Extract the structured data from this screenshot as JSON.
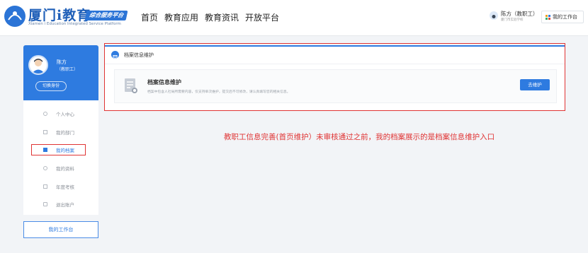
{
  "header": {
    "logo_title": "厦门i教育",
    "logo_subtitle": "Xiamen i Education Integrated Service Platform",
    "logo_badge": "综合服务平台",
    "nav": [
      "首页",
      "教育应用",
      "教育资讯",
      "开放平台"
    ],
    "user_name": "陈方（教职工）",
    "user_school": "厦门市实验学校",
    "workbench_label": "我的工作台"
  },
  "sidebar": {
    "name": "陈方",
    "role": "（教职工）",
    "switch_label": "切换身份",
    "menu": [
      {
        "label": "个人中心",
        "icon": "user-icon"
      },
      {
        "label": "我的部门",
        "icon": "department-icon"
      },
      {
        "label": "我的档案",
        "icon": "folder-icon"
      },
      {
        "label": "我的资料",
        "icon": "profile-icon"
      },
      {
        "label": "年度考核",
        "icon": "assessment-icon"
      },
      {
        "label": "退出账户",
        "icon": "logout-icon"
      }
    ],
    "active_item": "我的档案",
    "workbench_label": "我的工作台"
  },
  "panel": {
    "title": "档案信息维护",
    "item_title": "档案信息维护",
    "item_desc": "档案中包含人社局所需要内容，仅支持单次维护，提交后不可修改，请认真填写您的相关信息。",
    "button_label": "去维护"
  },
  "annotation": "教职工信息完善(首页维护）未审核通过之前，我的档案展示的是档案信息维护入口",
  "colors": {
    "accent": "#2e7be0",
    "highlight": "#e03434"
  }
}
